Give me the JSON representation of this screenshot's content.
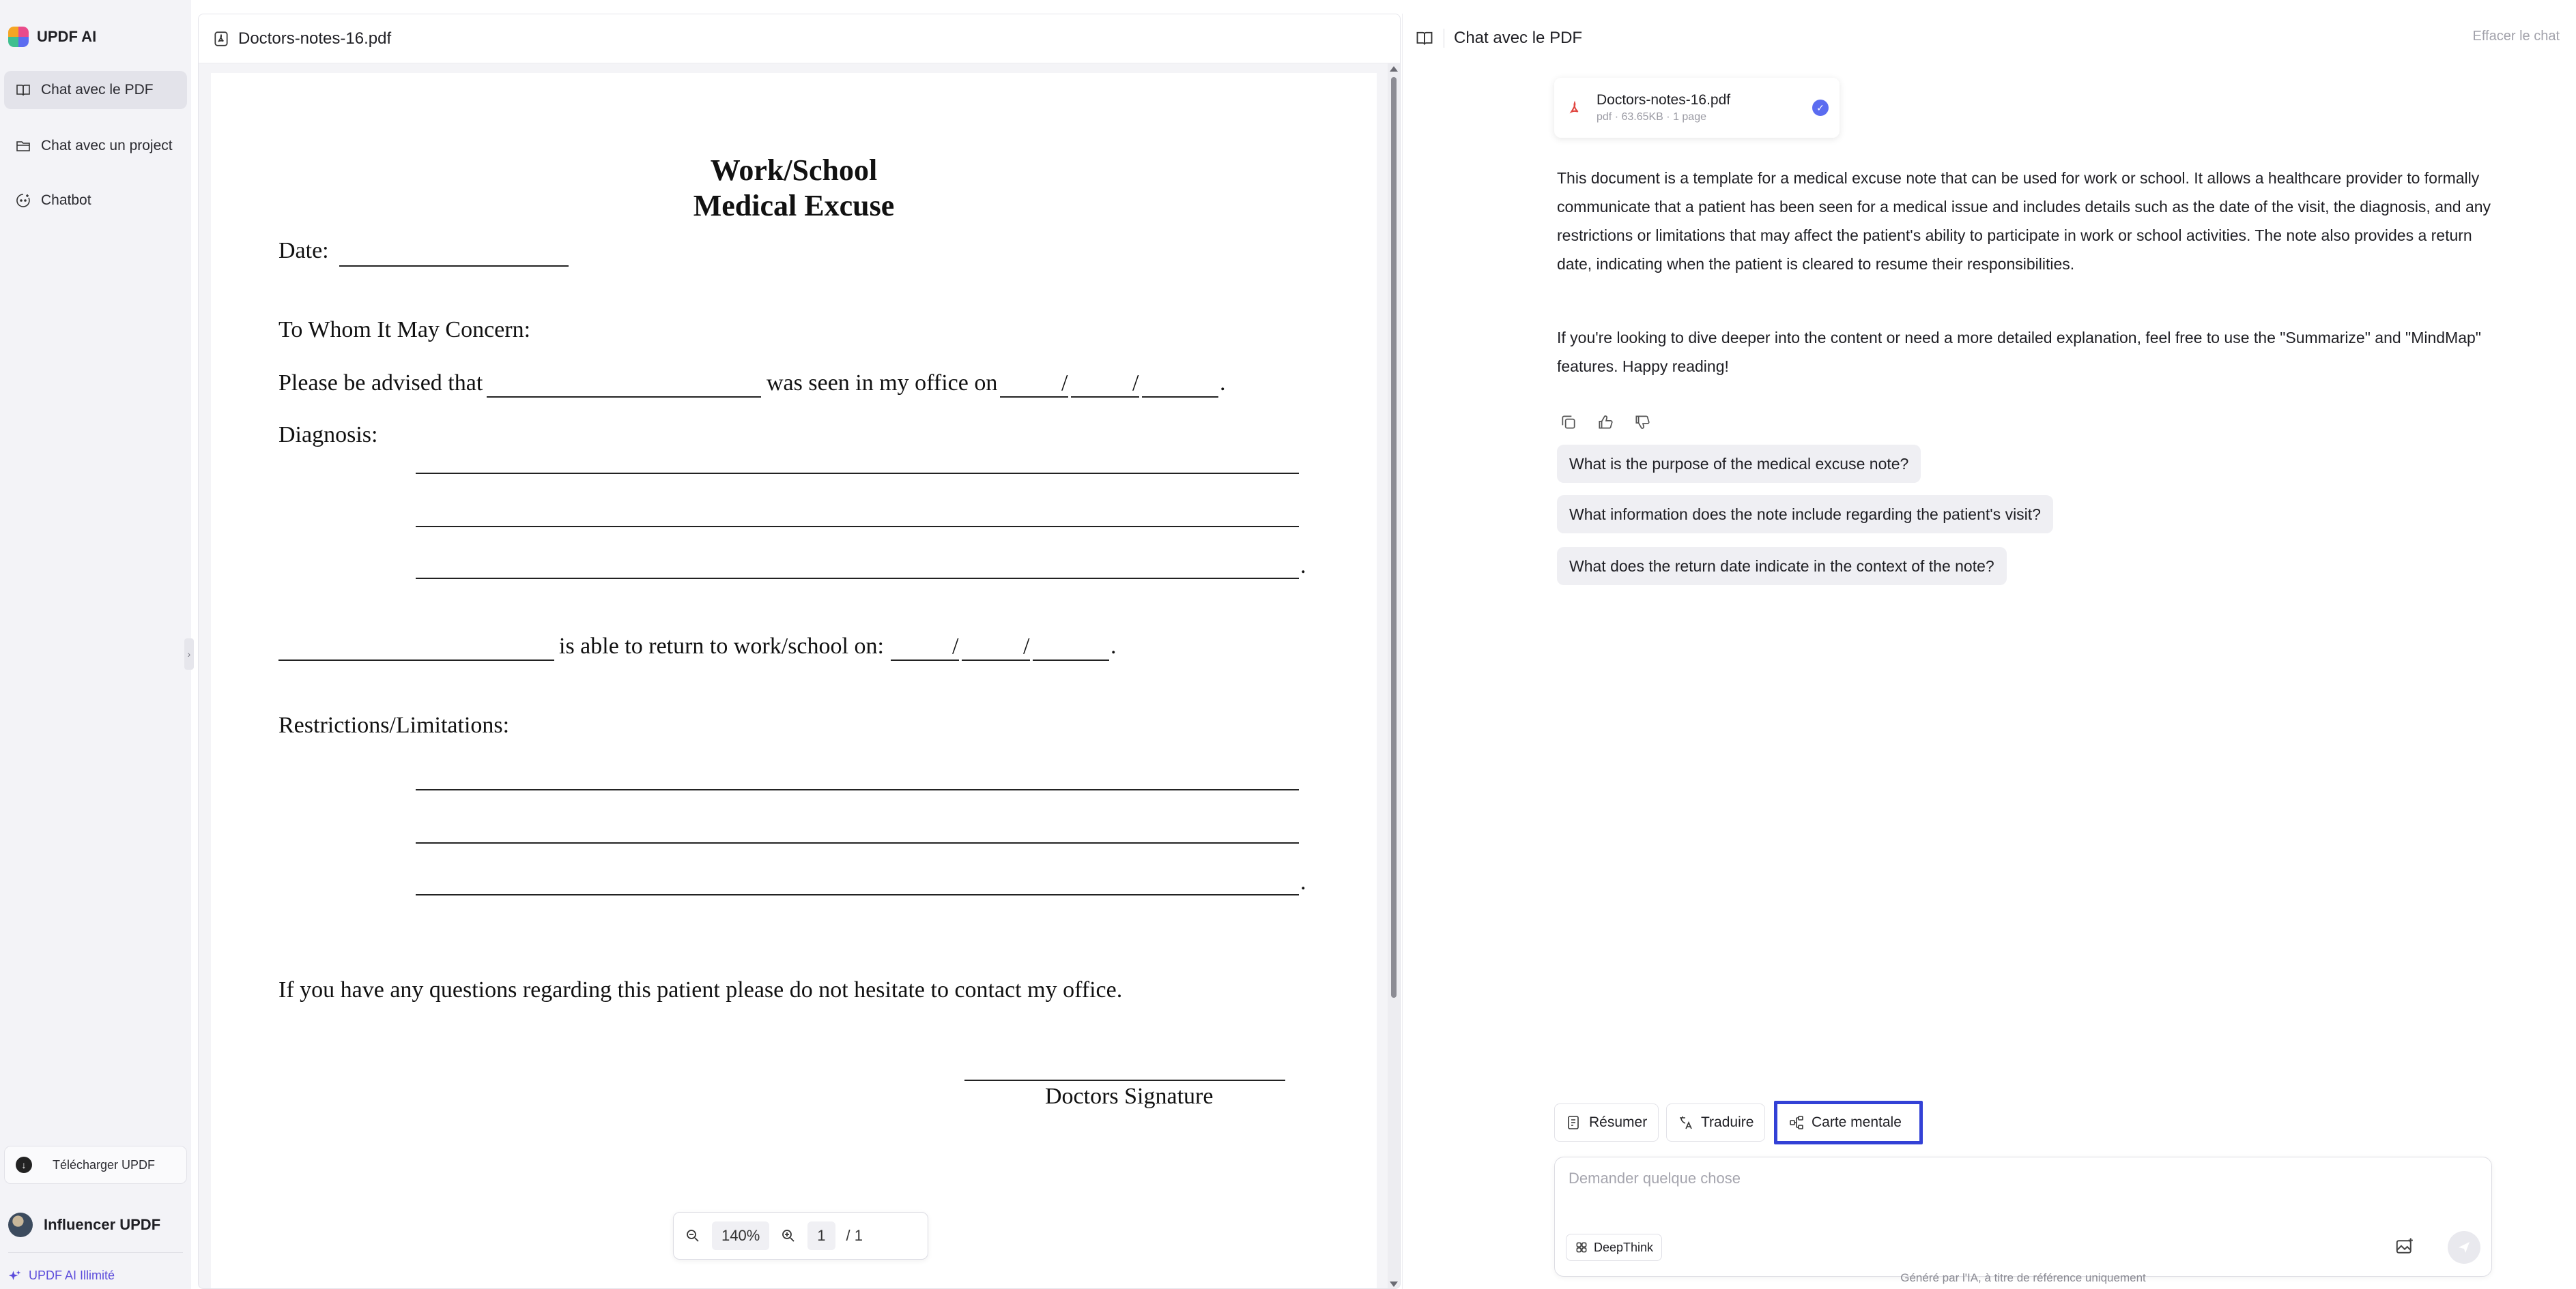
{
  "sidebar": {
    "brand": "UPDF AI",
    "items": [
      {
        "label": "Chat avec le PDF",
        "icon": "book-icon",
        "active": true
      },
      {
        "label": "Chat avec un project",
        "icon": "folder-icon",
        "active": false
      },
      {
        "label": "Chatbot",
        "icon": "chatbot-icon",
        "active": false
      }
    ],
    "download_label": "Télécharger UPDF",
    "user_name": "Influencer UPDF",
    "plan_label": "UPDF AI Illimité"
  },
  "pdf": {
    "file_name": "Doctors-notes-16.pdf",
    "zoom": "140%",
    "page_current": "1",
    "page_total": "/ 1",
    "document": {
      "title_line1": "Work/School",
      "title_line2": "Medical Excuse",
      "date_label": "Date:",
      "salutation": "To Whom It May Concern:",
      "advised_prefix": "Please be advised that",
      "advised_mid": "was seen in my office on",
      "diagnosis_label": "Diagnosis:",
      "return_text": "is able to return to work/school on:",
      "restrictions_label": "Restrictions/Limitations:",
      "questions_text": "If you have any questions regarding this patient please do not hesitate to contact my office.",
      "signature_label": "Doctors Signature",
      "slash": "/",
      "period": "."
    }
  },
  "chat": {
    "title": "Chat avec le PDF",
    "clear_label": "Effacer le chat",
    "file_card": {
      "name": "Doctors-notes-16.pdf",
      "meta": "pdf · 63.65KB · 1 page"
    },
    "answer_p1": "This document is a template for a medical excuse note that can be used for work or school. It allows a healthcare provider to formally communicate that a patient has been seen for a medical issue and includes details such as the date of the visit, the diagnosis, and any restrictions or limitations that may affect the patient's ability to participate in work or school activities. The note also provides a return date, indicating when the patient is cleared to resume their responsibilities.",
    "answer_p2": "If you're looking to dive deeper into the content or need a more detailed explanation, feel free to use the \"Summarize\" and \"MindMap\" features. Happy reading!",
    "suggestions": [
      "What is the purpose of the medical excuse note?",
      "What information does the note include regarding the patient's visit?",
      "What does the return date indicate in the context of the note?"
    ],
    "tools": {
      "summarize": "Résumer",
      "translate": "Traduire",
      "mindmap": "Carte mentale"
    },
    "input_placeholder": "Demander quelque chose",
    "deepthink_label": "DeepThink",
    "disclaimer": "Généré par l'IA, à titre de référence uniquement"
  },
  "colors": {
    "accent": "#5b6cf0",
    "highlight_border": "#3341d6",
    "plan_text": "#5b4bdb"
  }
}
